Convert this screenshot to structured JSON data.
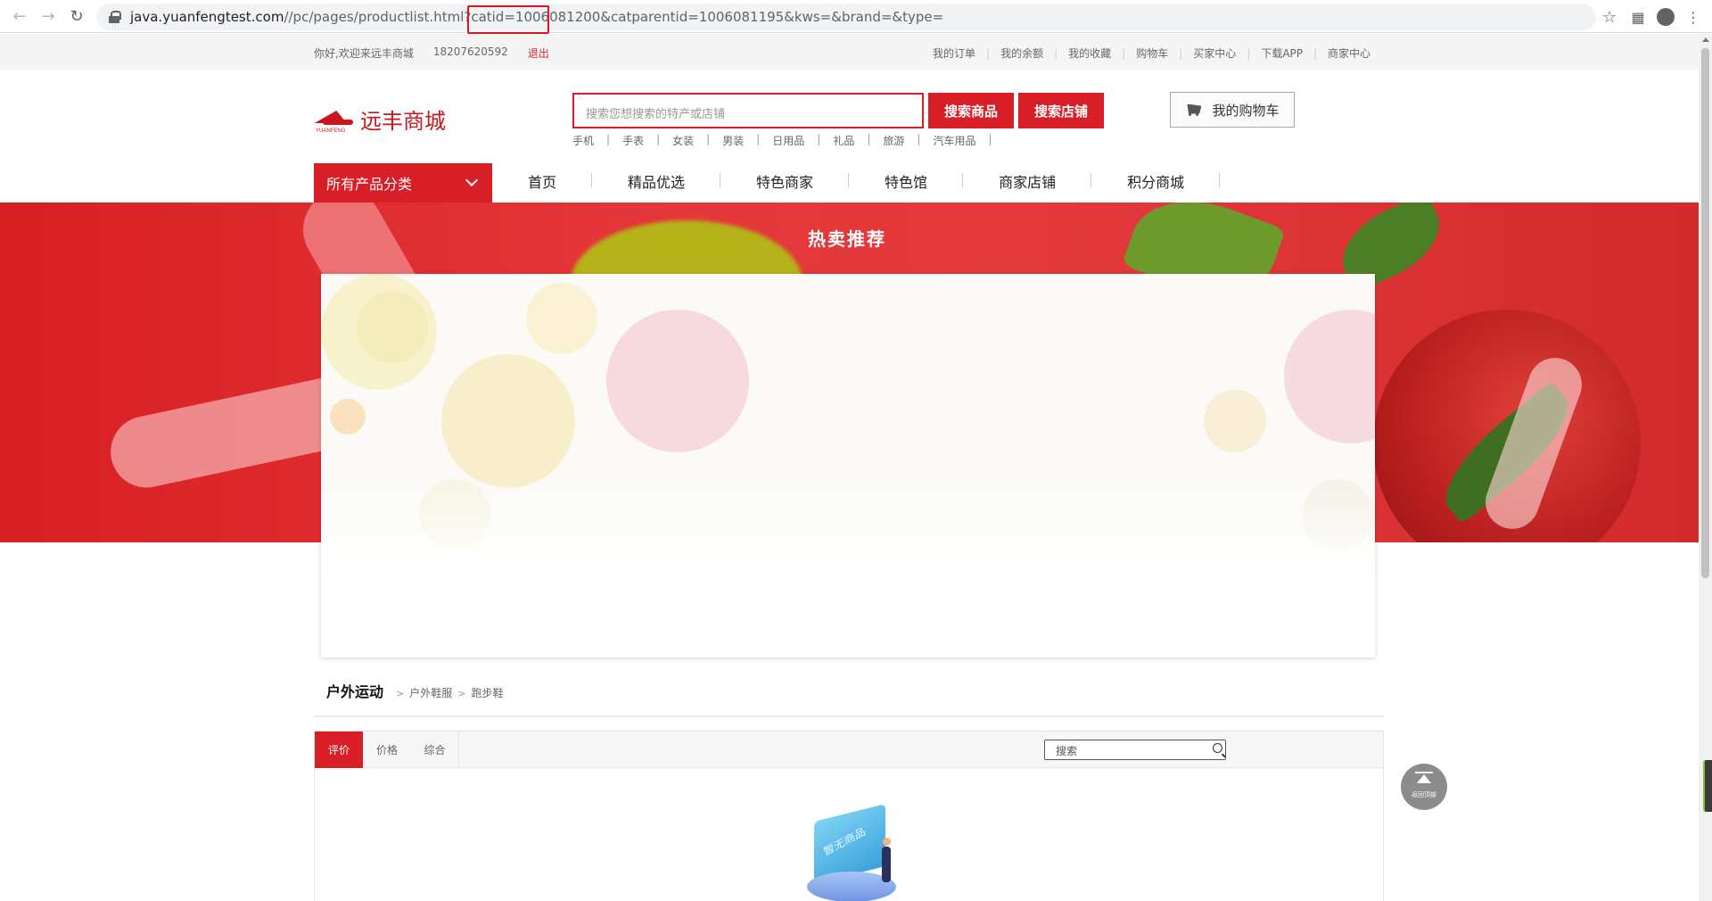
{
  "browser": {
    "url_host": "java.yuanfengtest.com",
    "url_path": "//pc/pages/productlist.html?catid=",
    "url_catid": "1006081200",
    "url_rest": "&catparentid=1006081195&kws=&brand=&type="
  },
  "topbar": {
    "welcome": "你好,欢迎来远丰商城",
    "phone": "18207620592",
    "logout": "退出",
    "links": [
      "我的订单",
      "我的余额",
      "我的收藏",
      "购物车",
      "买家中心",
      "下载APP",
      "商家中心"
    ]
  },
  "header": {
    "logo_text": "远丰商城",
    "logo_sub": "YUANFENG",
    "search_placeholder": "搜索您想搜索的特产或店铺",
    "search_goods": "搜索商品",
    "search_shops": "搜索店铺",
    "hot_words": [
      "手机",
      "手表",
      "女装",
      "男装",
      "日用品",
      "礼品",
      "旅游",
      "汽车用品"
    ],
    "cart": "我的购物车"
  },
  "nav": {
    "category": "所有产品分类",
    "items": [
      "首页",
      "精品优选",
      "特色商家",
      "特色馆",
      "商家店铺",
      "积分商城"
    ]
  },
  "banner": {
    "title": "热卖推荐"
  },
  "breadcrumb": {
    "root": "户外运动",
    "level2": "户外鞋服",
    "level3": "跑步鞋"
  },
  "sortbar": {
    "tabs": [
      "评价",
      "价格",
      "综合"
    ],
    "active_tab": 0,
    "search_placeholder": "搜索"
  },
  "empty_illustration_text": "暂无商品",
  "back_to_top": "返回顶部",
  "colors": {
    "brand_red": "#d81e26",
    "link_red": "#e0252a",
    "highlight_red": "#e0141e"
  }
}
